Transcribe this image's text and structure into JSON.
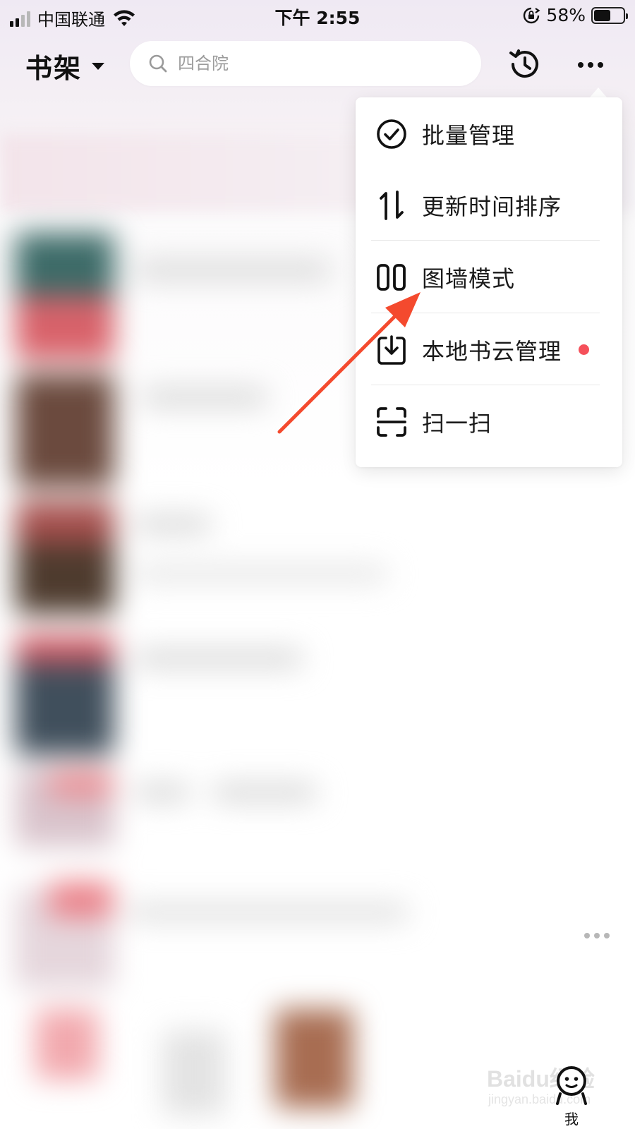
{
  "status_bar": {
    "carrier": "中国联通",
    "time": "下午 2:55",
    "battery_percent_text": "58%",
    "battery_level": 0.58,
    "signal_bars_active": 2,
    "signal_bars_total": 4,
    "icons": [
      "signal-icon",
      "wifi-icon",
      "orientation-lock-icon",
      "battery-icon"
    ]
  },
  "header": {
    "title": "书架",
    "search": {
      "placeholder": "四合院",
      "value": ""
    },
    "history_icon": "history-clock-icon",
    "more_icon": "more-dots-icon"
  },
  "menu": {
    "items": [
      {
        "label": "批量管理",
        "icon": "check-circle-icon"
      },
      {
        "label": "更新时间排序",
        "icon": "sort-arrows-icon"
      },
      {
        "label": "图墙模式",
        "icon": "grid-wall-icon"
      },
      {
        "label": "本地书云管理",
        "icon": "cloud-import-icon",
        "badge": "red-dot"
      },
      {
        "label": "扫一扫",
        "icon": "scan-icon"
      }
    ]
  },
  "annotation": {
    "color": "#f44a2e"
  },
  "bottom": {
    "me_label": "我",
    "watermark_main": "Baidu经验",
    "watermark_sub": "jingyan.baidu.com"
  },
  "colors": {
    "accent_red": "#f5505a",
    "text_primary": "#111111"
  }
}
